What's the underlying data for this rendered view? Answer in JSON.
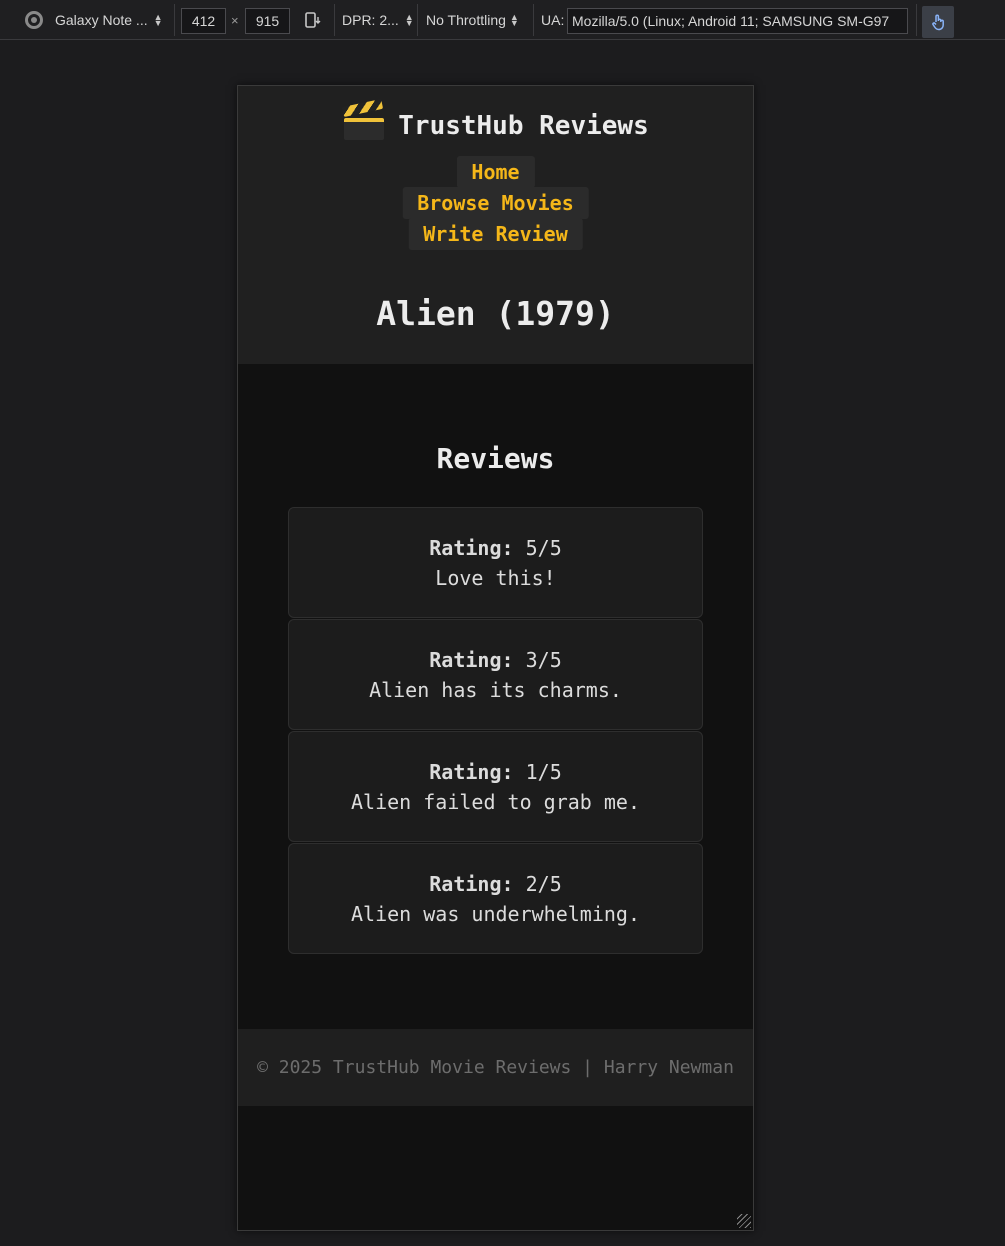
{
  "devtools": {
    "device_name": "Galaxy Note ...",
    "width": "412",
    "times": "×",
    "height": "915",
    "dpr_label": "DPR: 2...",
    "throttling": "No Throttling",
    "ua_label": "UA:",
    "ua_value": "Mozilla/5.0 (Linux; Android 11; SAMSUNG SM-G97"
  },
  "site": {
    "brand_icon": "clapperboard-icon",
    "brand_name": "TrustHub Reviews",
    "nav": [
      {
        "label": "Home"
      },
      {
        "label": "Browse Movies"
      },
      {
        "label": "Write Review"
      }
    ],
    "accent_color": "#f5b719",
    "page_title": "Alien (1979)",
    "reviews_heading": "Reviews",
    "rating_label": "Rating:",
    "reviews": [
      {
        "rating": "5/5",
        "text": "Love this!"
      },
      {
        "rating": "3/5",
        "text": "Alien has its charms."
      },
      {
        "rating": "1/5",
        "text": "Alien failed to grab me."
      },
      {
        "rating": "2/5",
        "text": "Alien was underwhelming."
      }
    ],
    "footer": "© 2025 TrustHub Movie Reviews | Harry Newman"
  }
}
